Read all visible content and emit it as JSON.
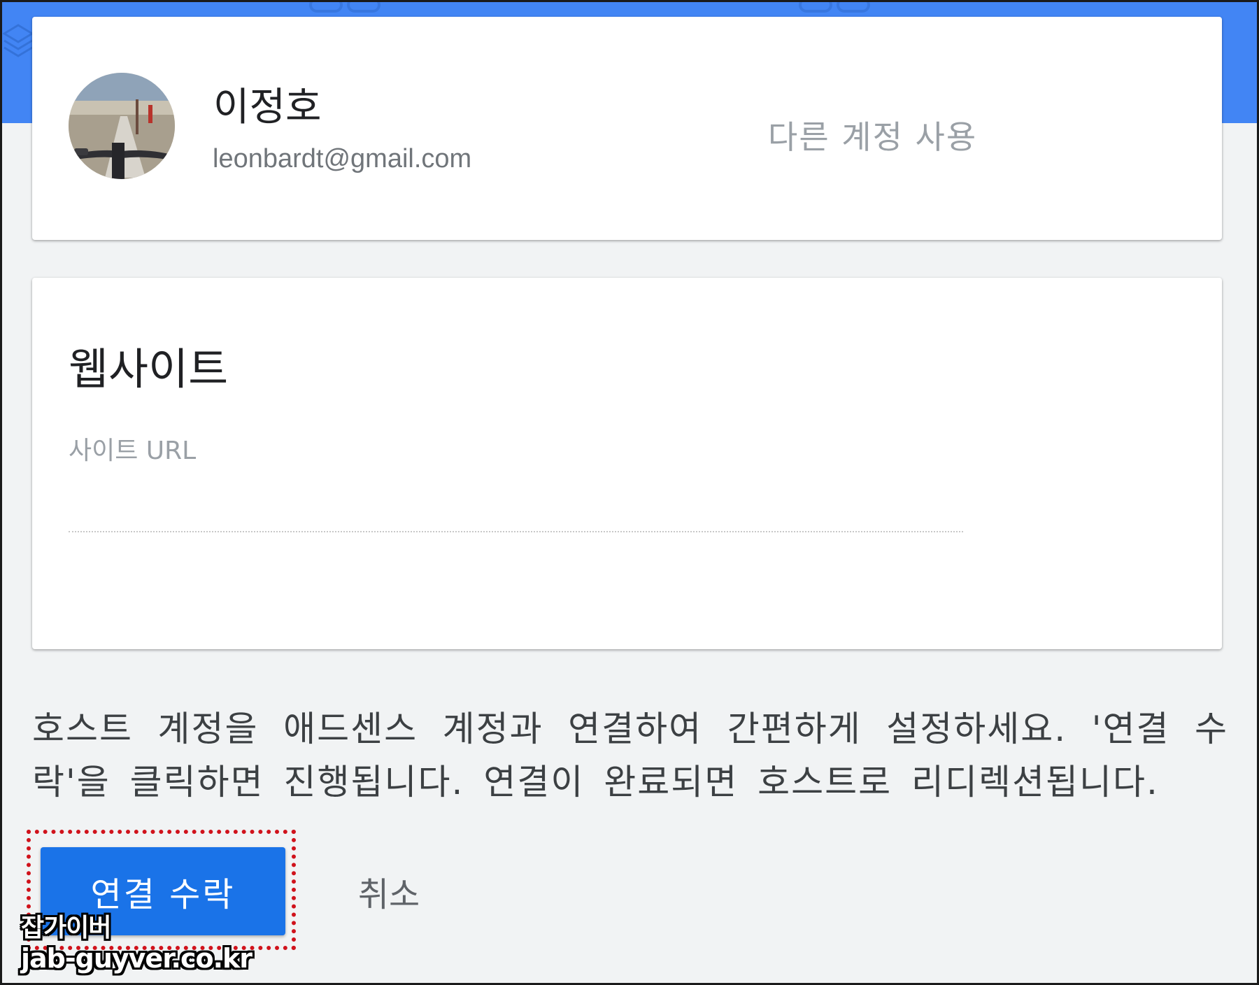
{
  "account": {
    "name": "이정호",
    "email": "leonbardt@gmail.com",
    "switch_label": "다른 계정 사용",
    "avatar_icon": "user-avatar-photo"
  },
  "website": {
    "heading": "웹사이트",
    "url_label": "사이트 URL",
    "url_value": ""
  },
  "description": "호스트 계정을 애드센스 계정과 연결하여 간편하게 설정하세요. '연결 수락'을 클릭하면 진행됩니다. 연결이 완료되면 호스트로 리디렉션됩니다.",
  "actions": {
    "accept_label": "연결 수락",
    "cancel_label": "취소"
  },
  "watermark": {
    "line1": "잡가이버",
    "line2": "jab-guyver.co.kr"
  },
  "colors": {
    "header_band": "#4285f4",
    "primary_button": "#1a73e8",
    "highlight_border": "#d0121b",
    "background": "#f1f3f4"
  }
}
